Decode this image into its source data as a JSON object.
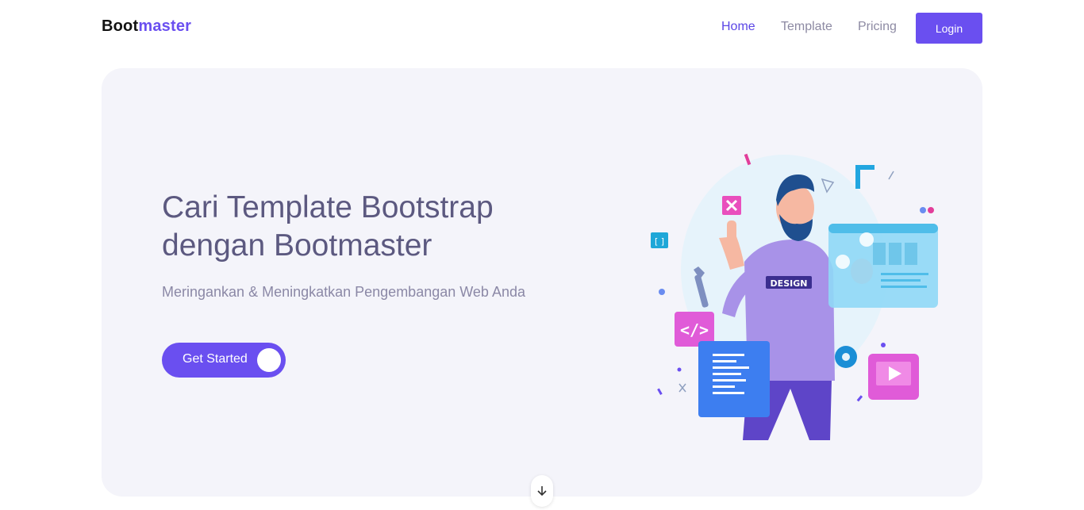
{
  "brand": {
    "part1": "Boot",
    "part2": "master"
  },
  "nav": {
    "items": [
      {
        "label": "Home",
        "active": true
      },
      {
        "label": "Template",
        "active": false
      },
      {
        "label": "Pricing",
        "active": false
      }
    ],
    "login_label": "Login"
  },
  "hero": {
    "title_line1": "Cari Template Bootstrap",
    "title_line2": "dengan Bootmaster",
    "subtitle": "Meringankan & Meningkatkan Pengembangan Web Anda",
    "cta_label": "Get Started",
    "illustration_badge": "DESIGN"
  },
  "icons": {
    "scroll": "arrow-down-icon",
    "code": "code-icon",
    "close": "close-icon",
    "play": "play-icon",
    "gear": "gear-icon",
    "wrench": "wrench-icon",
    "brackets": "brackets-icon"
  },
  "colors": {
    "accent": "#6a4ff0",
    "hero_bg": "#f4f4fa",
    "title": "#5c5980",
    "muted": "#8d8aa3"
  }
}
